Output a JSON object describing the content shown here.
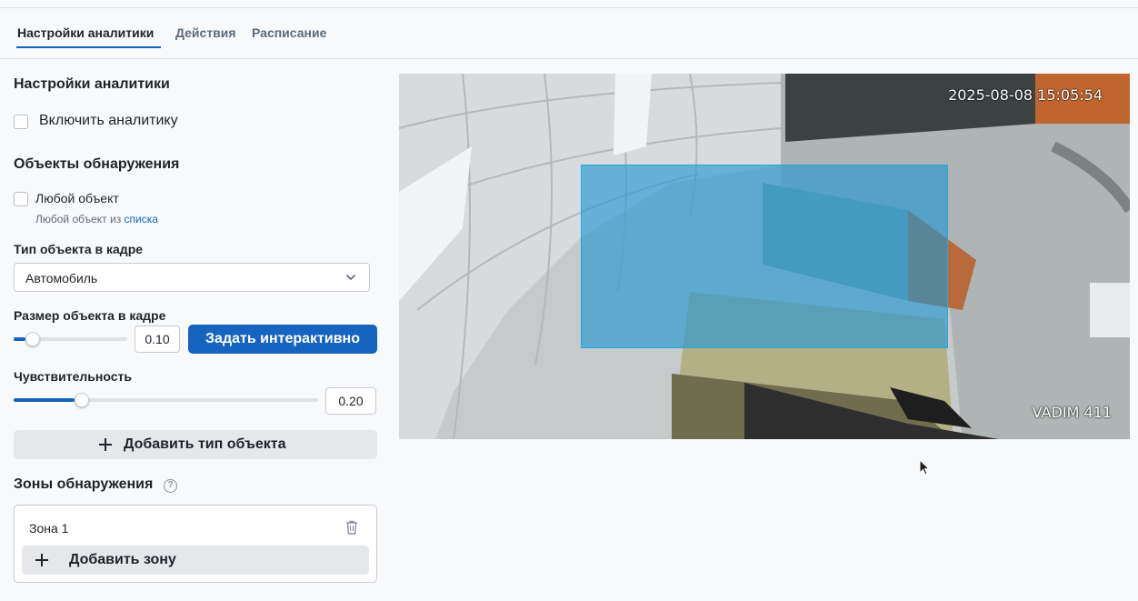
{
  "tabs": [
    {
      "label": "Настройки аналитики"
    },
    {
      "label": "Действия"
    },
    {
      "label": "Расписание"
    }
  ],
  "panel": {
    "section_title": "Настройки аналитики",
    "enable_label": "Включить аналитику",
    "objects_title": "Объекты обнаружения",
    "any_object_label": "Любой объект",
    "any_object_hint": "Любой объект из",
    "any_object_hint_link": "списка",
    "object_type_label": "Тип объекта в кадре",
    "object_type_value": "Автомобиль",
    "size_label": "Размер объекта в кадре",
    "size_value": "0.10",
    "size_fraction": 0.1,
    "set_interactive_label": "Задать интерактивно",
    "sensitivity_label": "Чувствительность",
    "sensitivity_value": "0.20",
    "sensitivity_fraction": 0.2,
    "add_object_type_label": "Добавить тип объекта",
    "zones_title": "Зоны обнаружения",
    "help_glyph": "?",
    "zones": [
      {
        "name": "Зона 1"
      }
    ],
    "add_zone_label": "Добавить зону"
  },
  "camera": {
    "timestamp": "2025-08-08 15:05:54",
    "camera_name": "VADIM 411"
  },
  "colors": {
    "accent": "#1565c0",
    "zone_fill": "#1e96d2",
    "zone_border": "#29a8e0"
  }
}
